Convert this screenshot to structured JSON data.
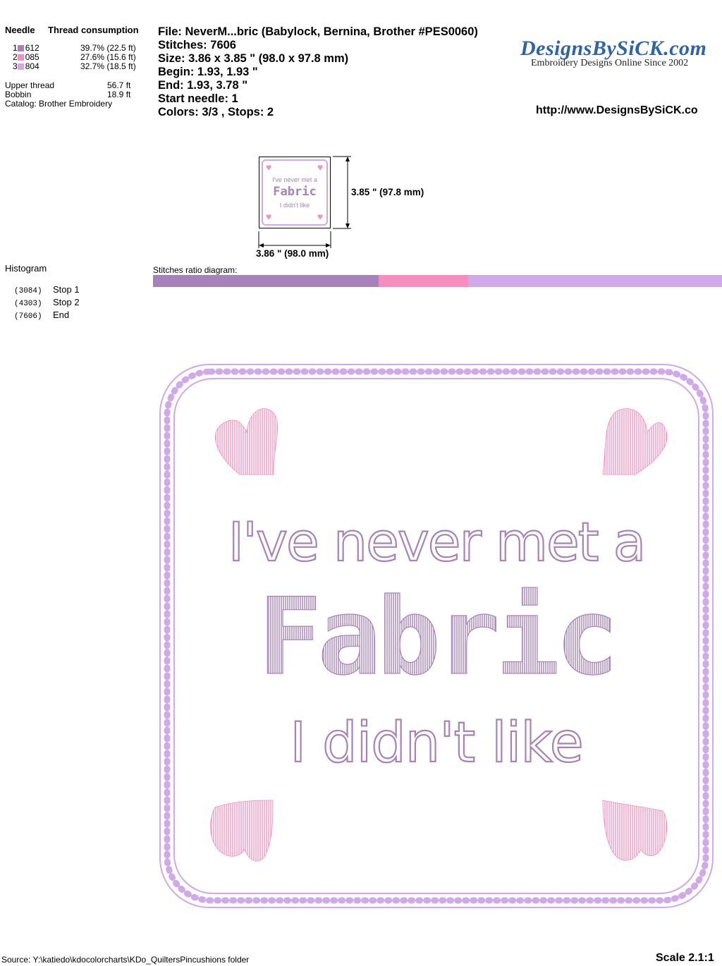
{
  "thread_table": {
    "needle_header": "Needle",
    "consumption_header": "Thread consumption",
    "rows": [
      {
        "num": "1",
        "code": "612",
        "pct": "39.7% (22.5 ft)",
        "color": "#a782b8"
      },
      {
        "num": "2",
        "code": "085",
        "pct": "27.6% (15.6 ft)",
        "color": "#f68dbd"
      },
      {
        "num": "3",
        "code": "804",
        "pct": "32.7% (18.5 ft)",
        "color": "#cfa9e8"
      }
    ],
    "upper_thread_label": "Upper thread",
    "upper_thread_value": "56.7 ft",
    "bobbin_label": "Bobbin",
    "bobbin_value": "18.9 ft",
    "catalog": "Catalog: Brother Embroidery"
  },
  "info": {
    "file": "File: NeverM...bric  (Babylock, Bernina, Brother #PES0060)",
    "stitches": "Stitches: 7606",
    "size": "Size: 3.86 x 3.85 \" (98.0 x 97.8 mm)",
    "begin": "Begin: 1.93, 1.93 \"",
    "end": "End: 1.93, 3.78 \"",
    "start_needle": "Start needle: 1",
    "colors": "Colors: 3/3 , Stops: 2"
  },
  "logo": {
    "name": "DesignsBySiCK.com",
    "tagline": "Embroidery Designs Online Since 2002",
    "url": "http://www.DesignsBySiCK.co"
  },
  "thumbnail": {
    "line1": "I've never met a",
    "line2": "Fabric",
    "line3": "I didn't like",
    "height_label": "3.85 \" (97.8 mm)",
    "width_label": "3.86 \" (98.0 mm)"
  },
  "histogram": {
    "title": "Histogram",
    "stops": [
      {
        "count": "(3084)",
        "label": "Stop 1"
      },
      {
        "count": "(4303)",
        "label": "Stop 2"
      },
      {
        "count": "(7606)",
        "label": "End"
      }
    ]
  },
  "ratio": {
    "label": "Stitches ratio diagram:",
    "segments": [
      {
        "fraction": 0.397,
        "color": "#a782b8"
      },
      {
        "fraction": 0.157,
        "color": "#f68dbd"
      },
      {
        "fraction": 0.446,
        "color": "#cfa9e8"
      }
    ]
  },
  "design": {
    "line1": "I've never met a",
    "line2": "Fabric",
    "line3": "I didn't like",
    "text_color": "#a782b8",
    "heart_color": "#f68dbd",
    "border_color": "#cfa9e8"
  },
  "footer": {
    "source": "Source: Y:\\katiedo\\kdocolorcharts\\KDo_QuiltersPincushions folder",
    "scale": "Scale 2.1:1"
  }
}
